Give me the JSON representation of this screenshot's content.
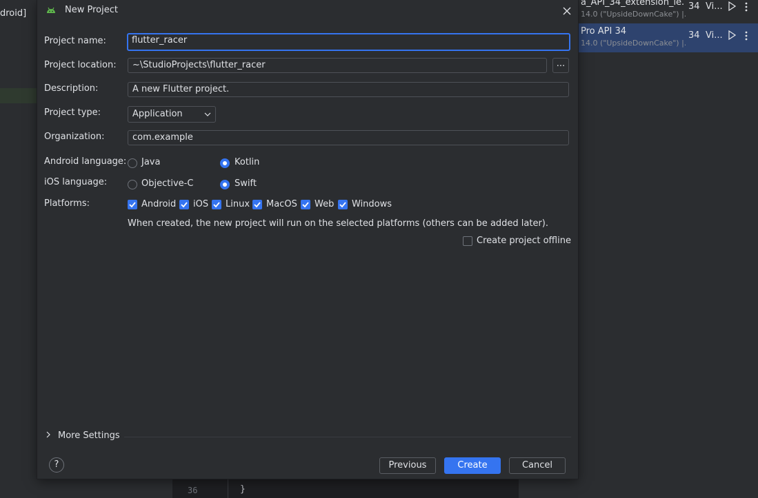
{
  "background": {
    "left_title": "droid]",
    "devices": [
      {
        "name": "a_API_34_extension_le...",
        "sub": "14.0 (\"UpsideDownCake\") |...",
        "api": "34",
        "type": "Vi...",
        "selected": false
      },
      {
        "name": "Pro API 34",
        "sub": "14.0 (\"UpsideDownCake\") |...",
        "api": "34",
        "type": "Vi...",
        "selected": true
      }
    ],
    "editor": {
      "line_number": "36",
      "code": "}"
    }
  },
  "dialog": {
    "title": "New Project",
    "project_name": {
      "label": "Project name:",
      "value": "flutter_racer"
    },
    "project_location": {
      "label": "Project location:",
      "value": "~\\StudioProjects\\flutter_racer",
      "browse_label": "..."
    },
    "description": {
      "label": "Description:",
      "value": "A new Flutter project."
    },
    "project_type": {
      "label": "Project type:",
      "value": "Application"
    },
    "organization": {
      "label": "Organization:",
      "value": "com.example"
    },
    "android_language": {
      "label": "Android language:",
      "options": [
        "Java",
        "Kotlin"
      ],
      "selected": "Kotlin"
    },
    "ios_language": {
      "label": "iOS language:",
      "options": [
        "Objective-C",
        "Swift"
      ],
      "selected": "Swift"
    },
    "platforms": {
      "label": "Platforms:",
      "items": [
        {
          "label": "Android",
          "checked": true
        },
        {
          "label": "iOS",
          "checked": true
        },
        {
          "label": "Linux",
          "checked": true
        },
        {
          "label": "MacOS",
          "checked": true
        },
        {
          "label": "Web",
          "checked": true
        },
        {
          "label": "Windows",
          "checked": true
        }
      ]
    },
    "platforms_hint": "When created, the new project will run on the selected platforms (others can be added later).",
    "offline": {
      "label": "Create project offline",
      "checked": false
    },
    "more_settings": "More Settings",
    "help": "?",
    "buttons": {
      "previous": "Previous",
      "create": "Create",
      "cancel": "Cancel"
    }
  },
  "colors": {
    "accent": "#3574f0",
    "dialog_bg": "#2b2d30",
    "selection": "#2e436e"
  }
}
